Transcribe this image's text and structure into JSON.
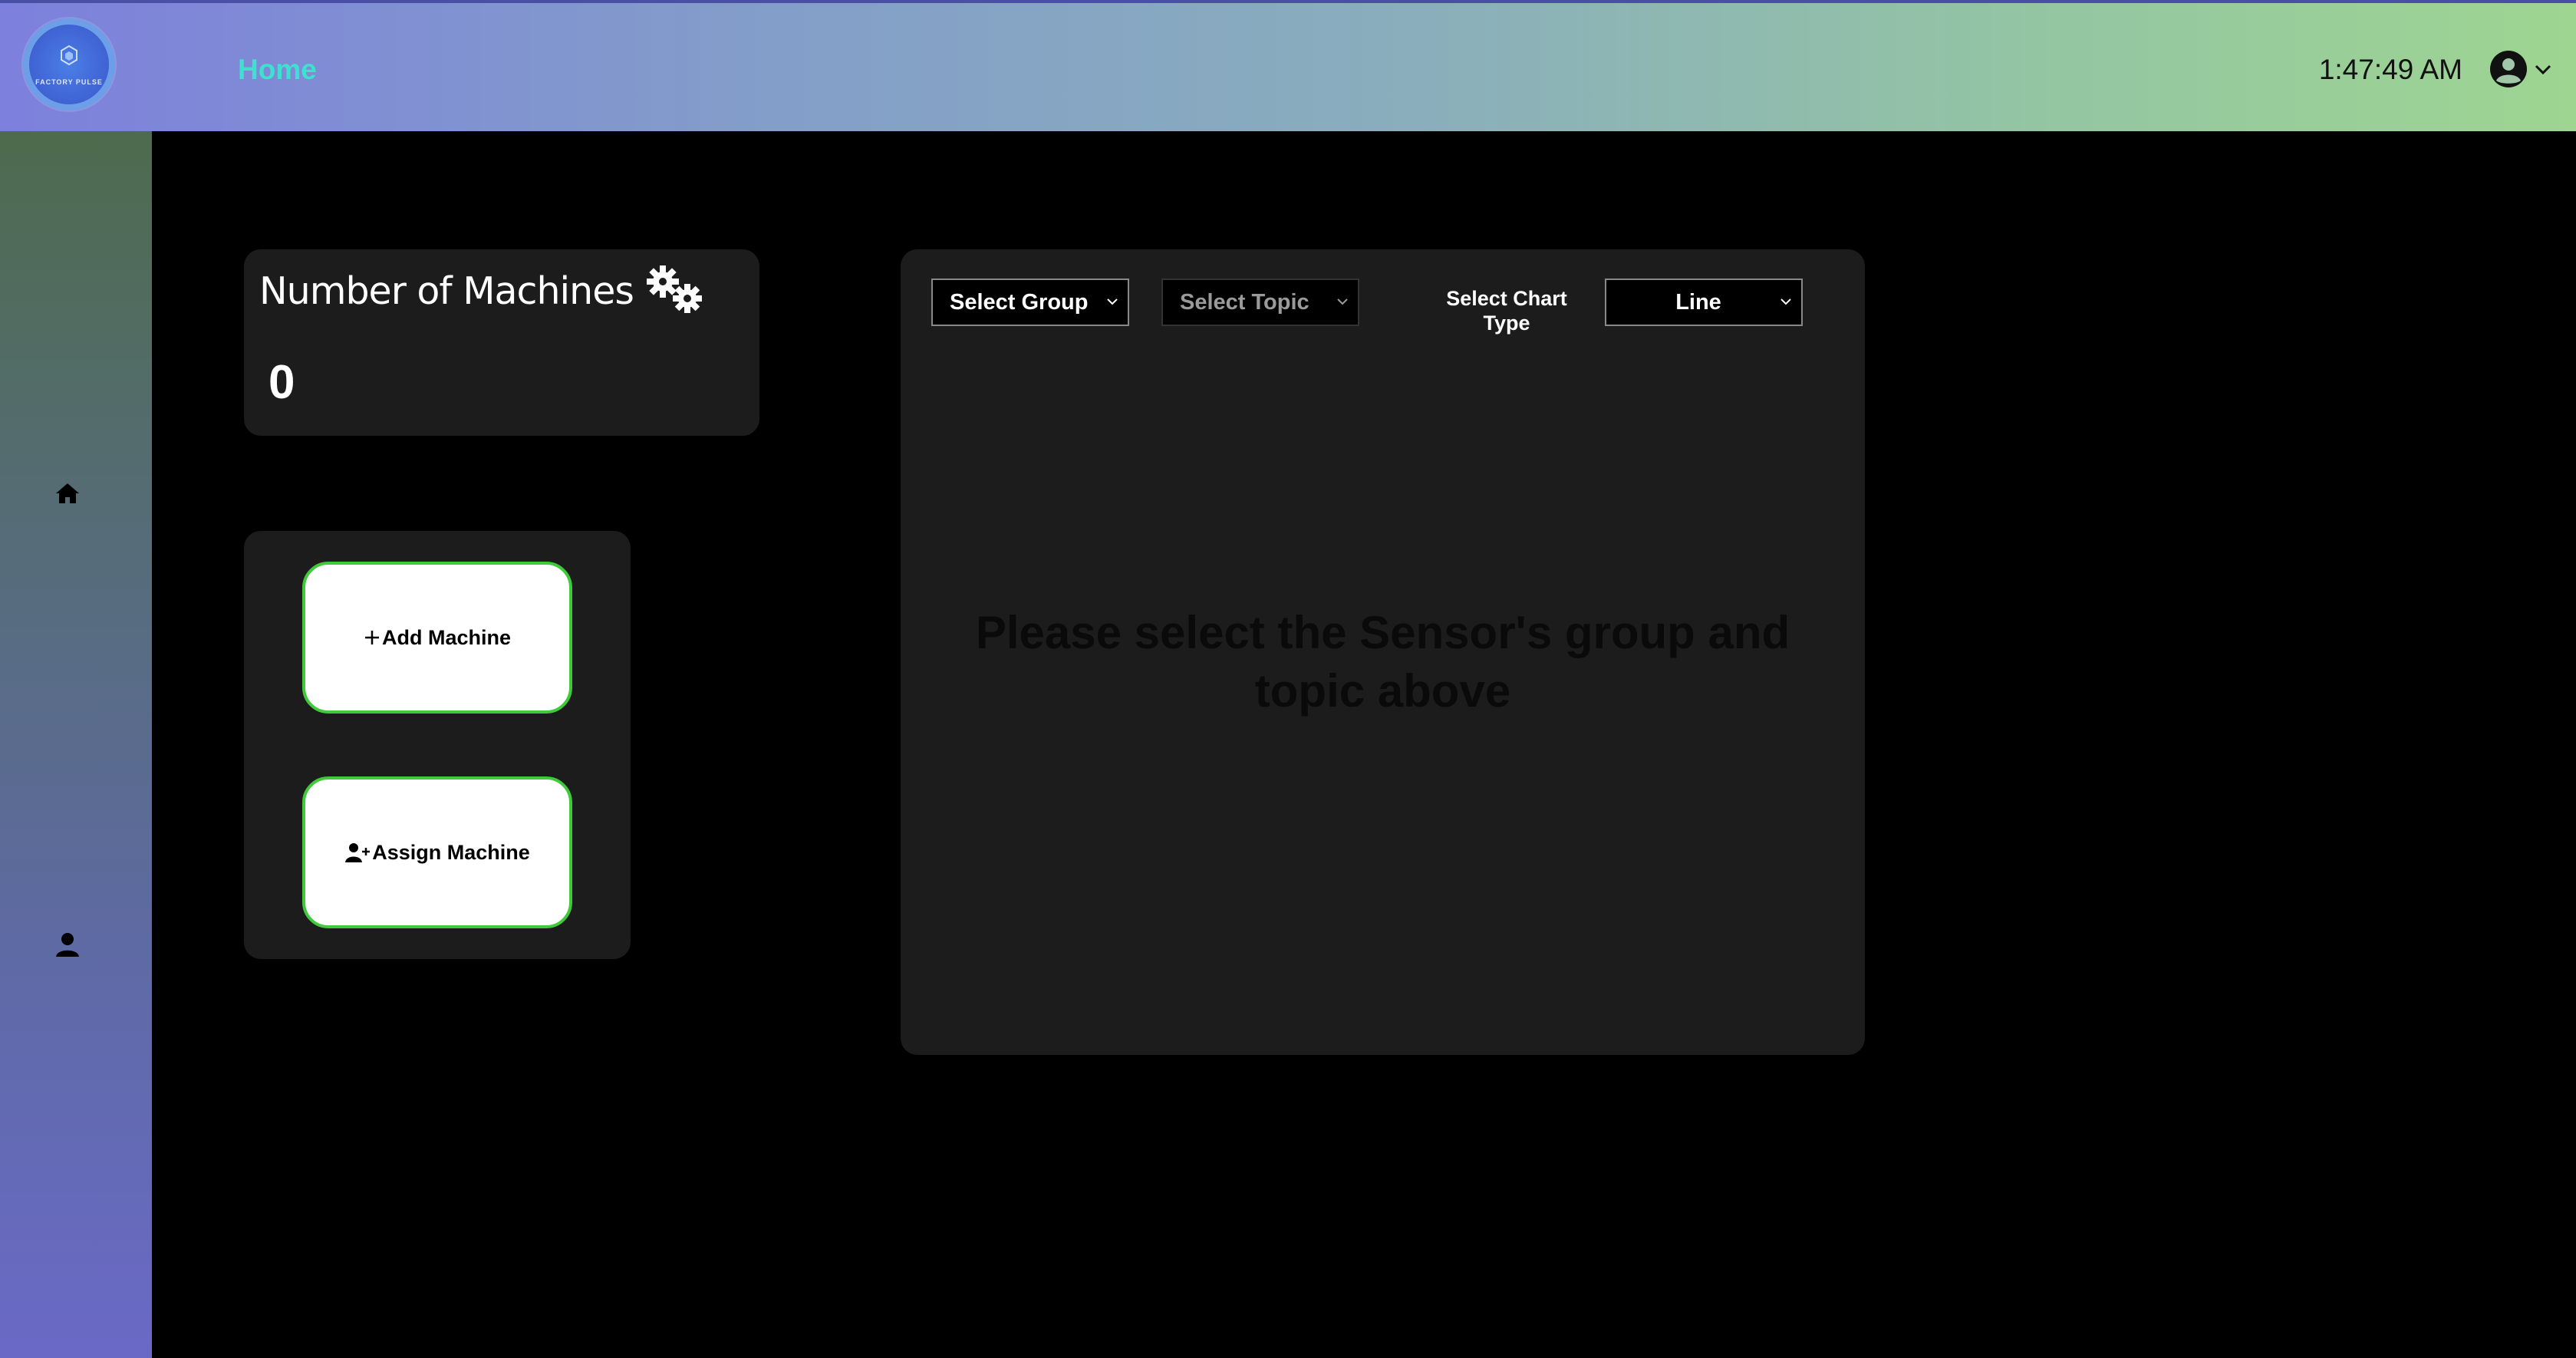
{
  "header": {
    "logo_text": "FACTORY PULSE",
    "nav_home": "Home",
    "clock": "1:47:49 AM",
    "user_icon": "user-circle-icon",
    "user_chevron": "chevron-down-icon"
  },
  "sidebar": {
    "items": [
      {
        "name": "home",
        "icon": "home-icon"
      },
      {
        "name": "profile",
        "icon": "user-icon"
      }
    ]
  },
  "machines_card": {
    "title": "Number of Machines",
    "count": "0",
    "icon": "gears-icon"
  },
  "actions": {
    "add_label": "Add Machine",
    "assign_label": "Assign Machine",
    "add_icon": "plus-icon",
    "assign_icon": "user-plus-icon"
  },
  "chart_panel": {
    "group_select": "Select Group",
    "topic_select": "Select Topic",
    "chart_type_label": "Select Chart Type",
    "chart_type_value": "Line",
    "empty_message": "Please select the Sensor's group and topic above"
  },
  "colors": {
    "accent_green": "#3fca3a",
    "home_link": "#3fe0d0",
    "card_bg": "#1c1c1c"
  }
}
